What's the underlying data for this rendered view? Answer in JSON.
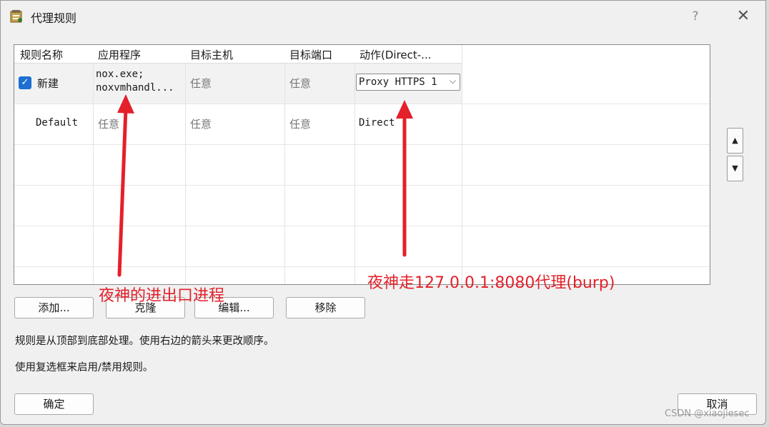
{
  "window": {
    "title": "代理规则",
    "help": "?",
    "close": "✕"
  },
  "table": {
    "headers": [
      "规则名称",
      "应用程序",
      "目标主机",
      "目标端口",
      "动作(Direct-..."
    ],
    "rows": [
      {
        "checked": true,
        "name": "新建",
        "app_line1": "nox.exe;",
        "app_line2": "noxvmhandl...",
        "host": "任意",
        "port": "任意",
        "action": "Proxy HTTPS 1"
      },
      {
        "name": "Default",
        "app": "任意",
        "host": "任意",
        "port": "任意",
        "action": "Direct"
      }
    ]
  },
  "move_up_icon": "triangle-up-icon",
  "move_down_icon": "triangle-down-icon",
  "buttons": {
    "add": "添加...",
    "clone": "克隆",
    "edit": "编辑...",
    "remove": "移除",
    "ok": "确定",
    "cancel": "取消"
  },
  "info": {
    "line1": "规则是从顶部到底部处理。使用右边的箭头来更改顺序。",
    "line2": "使用复选框来启用/禁用规则。"
  },
  "annotations": {
    "left": "夜神的进出口进程",
    "right": "夜神走127.0.0.1:8080代理(burp)",
    "color": "#e4202a"
  },
  "watermark": "CSDN @xiaojiesec"
}
